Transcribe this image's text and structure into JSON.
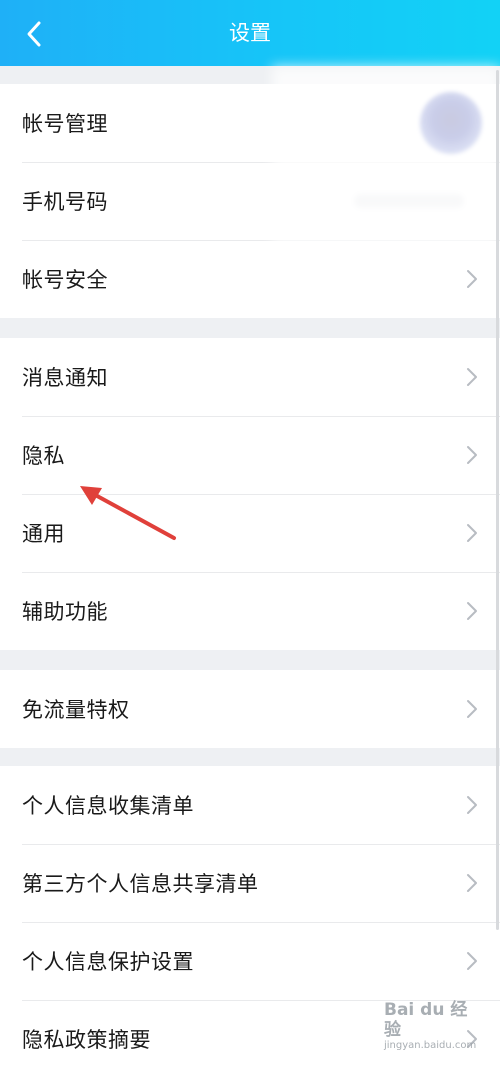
{
  "header": {
    "title": "设置",
    "back_icon": "chevron-left-icon"
  },
  "groups": [
    {
      "items": [
        {
          "label": "帐号管理",
          "accessory": "avatar"
        },
        {
          "label": "手机号码",
          "accessory": "masked-phone"
        },
        {
          "label": "帐号安全",
          "accessory": "chevron"
        }
      ]
    },
    {
      "items": [
        {
          "label": "消息通知",
          "accessory": "chevron"
        },
        {
          "label": "隐私",
          "accessory": "chevron"
        },
        {
          "label": "通用",
          "accessory": "chevron"
        },
        {
          "label": "辅助功能",
          "accessory": "chevron"
        }
      ]
    },
    {
      "items": [
        {
          "label": "免流量特权",
          "accessory": "chevron"
        }
      ]
    },
    {
      "items": [
        {
          "label": "个人信息收集清单",
          "accessory": "chevron"
        },
        {
          "label": "第三方个人信息共享清单",
          "accessory": "chevron"
        },
        {
          "label": "个人信息保护设置",
          "accessory": "chevron"
        },
        {
          "label": "隐私政策摘要",
          "accessory": "chevron"
        }
      ]
    }
  ],
  "annotation": {
    "icon": "red-arrow-icon",
    "color": "#e0403a"
  },
  "watermark": {
    "main": "Bai du 经验",
    "sub": "jingyan.baidu.com"
  },
  "colors": {
    "accent": "#1fb0f7",
    "chevron": "#b8bcc2",
    "background": "#eef0f3"
  }
}
